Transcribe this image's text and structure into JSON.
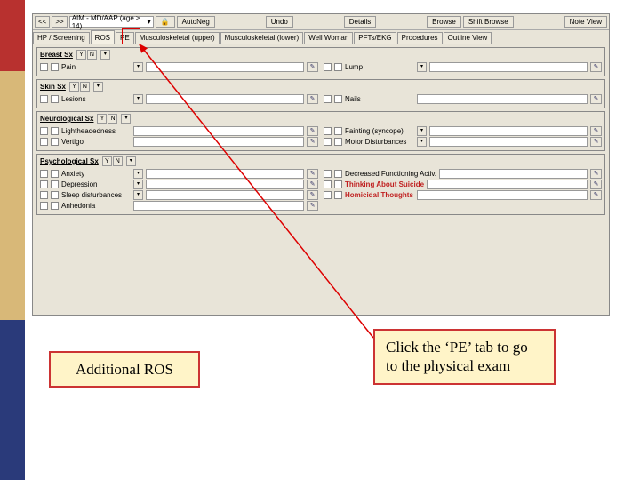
{
  "toolbar": {
    "prev": "<<",
    "next": ">>",
    "template": "AIM - MD/AAP (age ≥ 14)",
    "autoneg": "AutoNeg",
    "undo": "Undo",
    "details": "Details",
    "browse": "Browse",
    "shift_browse": "Shift Browse",
    "note_view": "Note View"
  },
  "tabs": {
    "t0": "HP / Screening",
    "t1": "ROS",
    "t2": "PE",
    "t3": "Musculoskeletal (upper)",
    "t4": "Musculoskeletal (lower)",
    "t5": "Well Woman",
    "t6": "PFTs/EKG",
    "t7": "Procedures",
    "t8": "Outline View"
  },
  "yn": {
    "y": "Y",
    "n": "N"
  },
  "panels": {
    "breast": {
      "title": "Breast Sx",
      "pain": "Pain",
      "lump": "Lump"
    },
    "skin": {
      "title": "Skin Sx",
      "lesions": "Lesions",
      "nails": "Nails"
    },
    "neuro": {
      "title": "Neurological Sx",
      "light": "Lightheadedness",
      "vertigo": "Vertigo",
      "fainting": "Fainting (syncope)",
      "motor": "Motor Disturbances"
    },
    "psych": {
      "title": "Psychological Sx",
      "anxiety": "Anxiety",
      "depression": "Depression",
      "sleep": "Sleep disturbances",
      "anhedonia": "Anhedonia",
      "decreased": "Decreased Functioning Activ.",
      "suicide": "Thinking About Suicide",
      "homicidal": "Homicidal Thoughts"
    }
  },
  "callouts": {
    "left": "Additional ROS",
    "right": "Click the ‘PE’ tab to go to the physical exam"
  }
}
